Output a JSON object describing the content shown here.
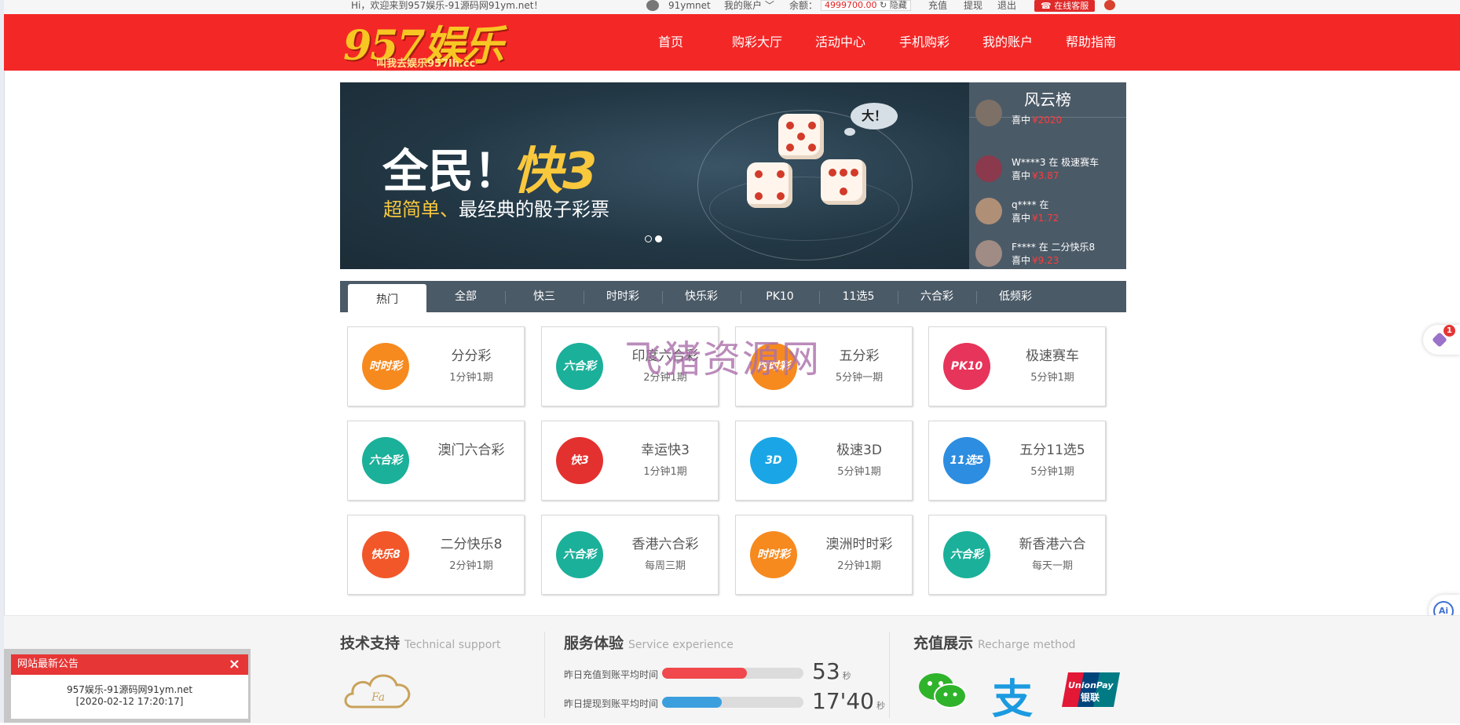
{
  "topbar": {
    "greeting": "Hi，欢迎来到957娱乐-91源码网91ym.net！",
    "username": "91ymnet",
    "account_menu": "我的账户 ﹀",
    "balance_label": "余额：",
    "balance_value": "4999700.00",
    "hide_label": "隐藏",
    "recharge": "充值",
    "withdraw": "提现",
    "logout": "退出",
    "online_service": "在线客服"
  },
  "logo": {
    "big": "957娱乐",
    "slogan": "叫我去娱乐957lh.cc"
  },
  "nav": [
    "首页",
    "购彩大厅",
    "活动中心",
    "手机购彩",
    "我的账户",
    "帮助指南"
  ],
  "banner": {
    "headline_white": "全民！",
    "headline_yellow": "快3",
    "sub_yellow": "超简单、",
    "sub_white": "最经典的骰子彩票",
    "bubble": "大！",
    "slide_count": 2,
    "active_slide": 2
  },
  "ranking": {
    "title": "风云榜",
    "entries": [
      {
        "line1": "",
        "line2": "喜中",
        "amount": "¥2020"
      },
      {
        "line1": "W****3 在 极速赛车",
        "line2": "喜中",
        "amount": "¥3.87"
      },
      {
        "line1": "q**** 在",
        "line2": "喜中",
        "amount": "¥1.72"
      },
      {
        "line1": "F**** 在 二分快乐8",
        "line2": "喜中",
        "amount": "¥9.23"
      }
    ]
  },
  "tabs": [
    "热门",
    "全部",
    "快三",
    "时时彩",
    "快乐彩",
    "PK10",
    "11选5",
    "六合彩",
    "低频彩"
  ],
  "active_tab": 0,
  "games": [
    {
      "name": "分分彩",
      "freq": "1分钟1期",
      "icon_text": "时时彩",
      "color": "#f68a1f"
    },
    {
      "name": "印度六合彩",
      "freq": "2分钟1期",
      "icon_text": "六合彩",
      "color": "#1bb09a"
    },
    {
      "name": "五分彩",
      "freq": "5分钟一期",
      "icon_text": "时时彩",
      "color": "#f68a1f"
    },
    {
      "name": "极速赛车",
      "freq": "5分钟1期",
      "icon_text": "PK10",
      "color": "#e7345a"
    },
    {
      "name": "澳门六合彩",
      "freq": "",
      "icon_text": "六合彩",
      "color": "#1bb09a"
    },
    {
      "name": "幸运快3",
      "freq": "1分钟1期",
      "icon_text": "快3",
      "color": "#e3312f"
    },
    {
      "name": "极速3D",
      "freq": "5分钟1期",
      "icon_text": "3D",
      "color": "#1aa6e6"
    },
    {
      "name": "五分11选5",
      "freq": "5分钟1期",
      "icon_text": "11选5",
      "color": "#2d8de0"
    },
    {
      "name": "二分快乐8",
      "freq": "2分钟1期",
      "icon_text": "快乐8",
      "color": "#f2572a"
    },
    {
      "name": "香港六合彩",
      "freq": "每周三期",
      "icon_text": "六合彩",
      "color": "#1bb09a"
    },
    {
      "name": "澳洲时时彩",
      "freq": "2分钟1期",
      "icon_text": "时时彩",
      "color": "#f68a1f"
    },
    {
      "name": "新香港六合",
      "freq": "每天一期",
      "icon_text": "六合彩",
      "color": "#1bb09a"
    }
  ],
  "watermark": "飞猪资源网",
  "side_badge": "1",
  "ai_label": "Ai",
  "footer": {
    "tech": {
      "title": "技术支持",
      "en": "Technical support",
      "cloud_text": "Fa"
    },
    "service": {
      "title": "服务体验",
      "en": "Service experience",
      "stats": [
        {
          "label": "昨日充值到账平均时间",
          "value": "53",
          "unit": "秒",
          "fill_fraction": 0.6,
          "color": "#f0484c"
        },
        {
          "label": "昨日提现到账平均时间",
          "value": "17'40",
          "unit": "秒",
          "fill_fraction": 0.42,
          "color": "#3b9fde"
        }
      ]
    },
    "recharge": {
      "title": "充值展示",
      "en": "Recharge method",
      "unionpay_en": "UnionPay",
      "unionpay_cn": "银联",
      "alipay_glyph": "支"
    }
  },
  "notice": {
    "title": "网站最新公告",
    "close": "×",
    "line1": "957娱乐-91源码网91ym.net",
    "line2": "[2020-02-12 17:20:17]"
  }
}
